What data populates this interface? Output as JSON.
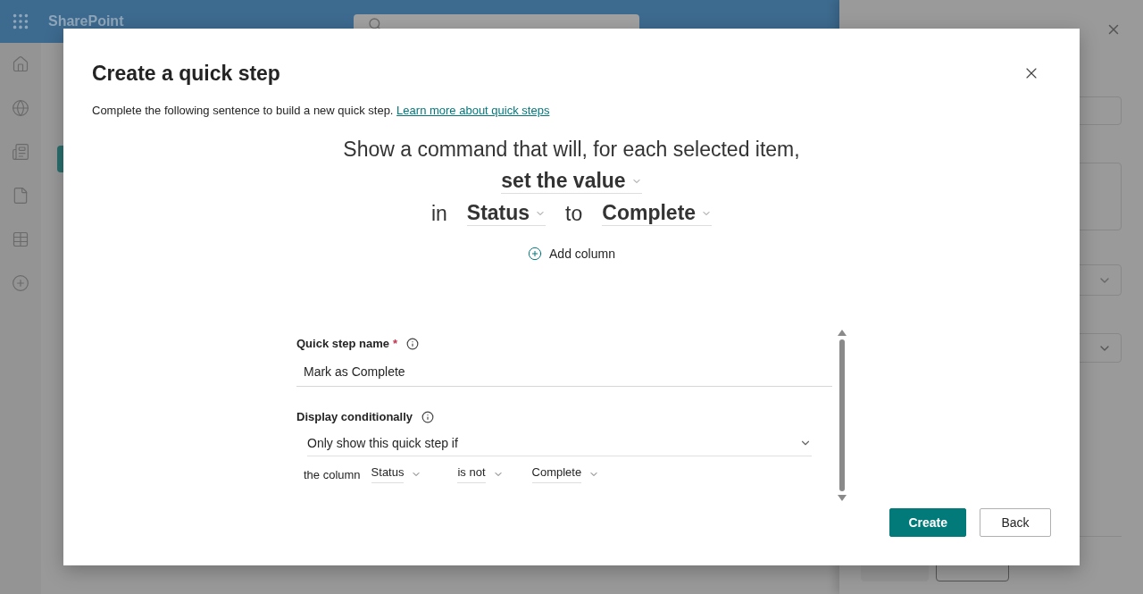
{
  "app": {
    "name": "SharePoint"
  },
  "dialog": {
    "title": "Create a quick step",
    "description": "Complete the following sentence to build a new quick step.",
    "link": "Learn more about quick steps",
    "sentence": [
      {
        "tokens": [
          {
            "kind": "text",
            "text": "Show a command that will, for each selected item,"
          }
        ]
      },
      {
        "tokens": [
          {
            "kind": "choice",
            "text": "set the value"
          }
        ]
      },
      {
        "tokens": [
          {
            "kind": "text",
            "text": "in"
          },
          {
            "kind": "choice",
            "text": "Status"
          },
          {
            "kind": "text",
            "text": "to"
          },
          {
            "kind": "choice",
            "text": "Complete"
          }
        ]
      }
    ],
    "add_column": "Add column",
    "name_field": {
      "label": "Quick step name",
      "required_mark": "*",
      "value": "Mark as Complete"
    },
    "condition_field": {
      "label": "Display conditionally",
      "mode": "Only show this quick step if",
      "prefix": "the column",
      "column": "Status",
      "operator": "is not",
      "value": "Complete"
    },
    "buttons": [
      {
        "label": "Create",
        "kind": "primary"
      },
      {
        "label": "Back",
        "kind": "secondary"
      }
    ]
  }
}
